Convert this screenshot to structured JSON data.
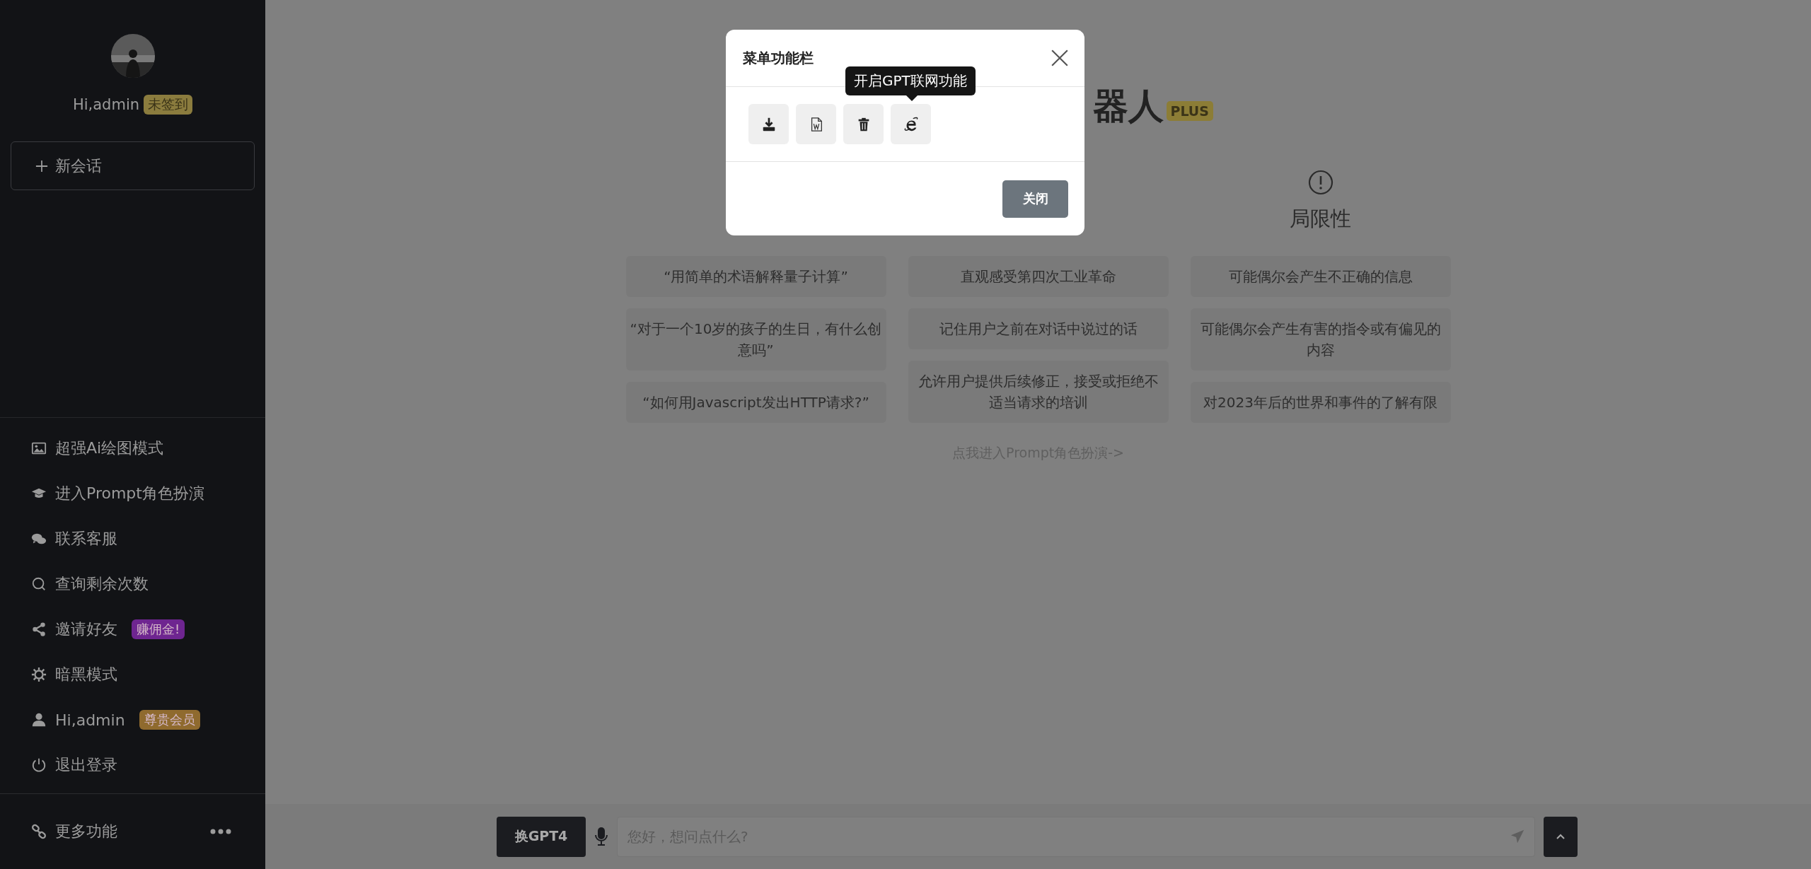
{
  "sidebar": {
    "greeting": "Hi,admin",
    "status_badge": "未签到",
    "new_chat": "新会话",
    "menu": [
      {
        "label": "超强Ai绘图模式"
      },
      {
        "label": "进入Prompt角色扮演"
      },
      {
        "label": "联系客服"
      },
      {
        "label": "查询剩余次数"
      },
      {
        "label": "邀请好友",
        "badge": {
          "text": "赚佣金!",
          "color": "#6e2590"
        }
      },
      {
        "label": "暗黑模式"
      },
      {
        "label": "Hi,admin",
        "badge": {
          "text": "尊贵会员",
          "color": "#8f6a2e"
        }
      },
      {
        "label": "退出登录"
      }
    ],
    "more": "更多功能"
  },
  "main": {
    "title": "器人",
    "title_badge": "PLUS",
    "columns": [
      {
        "items": [
          "“用简单的术语解释量子计算”",
          "“对于一个10岁的孩子的生日，有什么创意吗”",
          "“如何用Javascript发出HTTP请求?”"
        ]
      },
      {
        "items": [
          "直观感受第四次工业革命",
          "记住用户之前在对话中说过的话",
          "允许用户提供后续修正，接受或拒绝不适当请求的培训"
        ]
      },
      {
        "heading": "局限性",
        "items": [
          "可能偶尔会产生不正确的信息",
          "可能偶尔会产生有害的指令或有偏见的内容",
          "对2023年后的世界和事件的了解有限"
        ]
      }
    ],
    "prompt_link": "点我进入Prompt角色扮演->"
  },
  "composer": {
    "model_button": "换GPT4",
    "placeholder": "您好，想问点什么?"
  },
  "modal": {
    "title": "菜单功能栏",
    "tools": [
      {
        "kind": "download"
      },
      {
        "kind": "word"
      },
      {
        "kind": "delete"
      },
      {
        "kind": "browser",
        "tooltip": "开启GPT联网功能"
      }
    ],
    "close_button": "关闭"
  }
}
